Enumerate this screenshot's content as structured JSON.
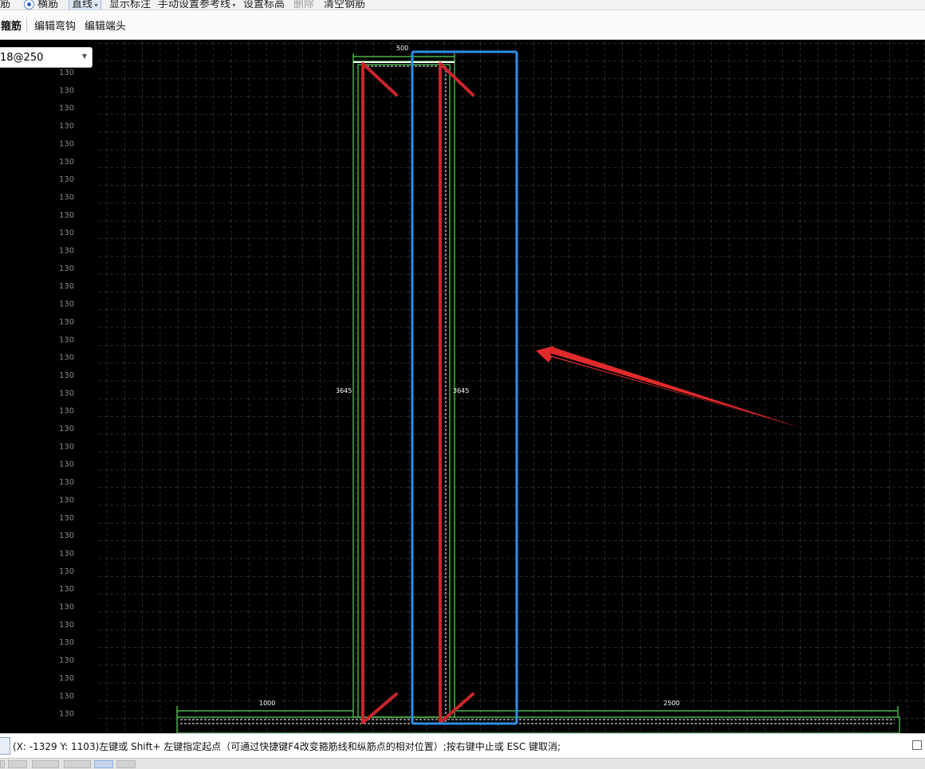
{
  "toolbar_top": {
    "items": [
      {
        "id": "tb-rebar-short",
        "label": "筋"
      },
      {
        "id": "tb-horizontal-rebar",
        "label": "横筋"
      },
      {
        "id": "tb-straight-line",
        "label": "直线"
      },
      {
        "id": "tb-show-annotation",
        "label": "显示标注"
      },
      {
        "id": "tb-manual-ref-line",
        "label": "手动设置参考线"
      },
      {
        "id": "tb-set-elevation",
        "label": "设置标高"
      },
      {
        "id": "tb-delete",
        "label": "删除"
      },
      {
        "id": "tb-clear-rebar",
        "label": "清空钢筋"
      }
    ]
  },
  "toolbar_second": {
    "stirrup_label": "箍筋",
    "edit_hook_label": "编辑弯钩",
    "edit_end_label": "编辑端头"
  },
  "rebar_spec": {
    "value": "18@250"
  },
  "drawing": {
    "row_label": "130",
    "dim_top": "500",
    "dim_left_height": "3645",
    "dim_right_height": "3645",
    "dim_bottom_left": "1000",
    "dim_bottom_right": "2500"
  },
  "status_bar": {
    "text": "(X: -1329 Y: 1103)左键或 Shift+ 左键指定起点（可通过快捷键F4改变箍筋线和纵筋点的相对位置）;按右键中止或 ESC 键取消;"
  },
  "colors": {
    "canvas_bg": "#000000",
    "grid": "#4a4a4a",
    "red_rebar": "#c8262b",
    "green_outline": "#58d858",
    "blue_highlight": "#2e8fe6",
    "arrow": "#e32a2a"
  }
}
